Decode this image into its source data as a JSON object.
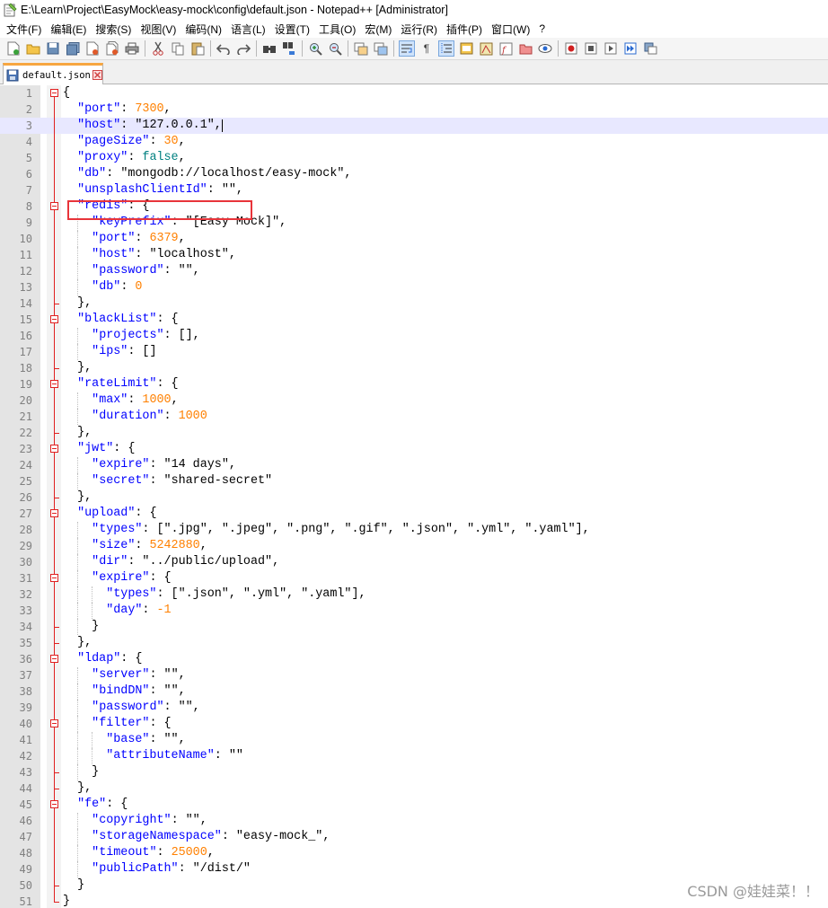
{
  "window": {
    "title": "E:\\Learn\\Project\\EasyMock\\easy-mock\\config\\default.json - Notepad++ [Administrator]"
  },
  "menu": [
    "文件(F)",
    "编辑(E)",
    "搜索(S)",
    "视图(V)",
    "编码(N)",
    "语言(L)",
    "设置(T)",
    "工具(O)",
    "宏(M)",
    "运行(R)",
    "插件(P)",
    "窗口(W)",
    "?"
  ],
  "toolbar": {
    "icons": [
      "new-file-icon",
      "open-file-icon",
      "save-icon",
      "save-all-icon",
      "close-icon",
      "close-all-icon",
      "print-icon",
      "cut-icon",
      "copy-icon",
      "paste-icon",
      "undo-icon",
      "redo-icon",
      "find-icon",
      "replace-icon",
      "zoom-in-icon",
      "zoom-out-icon",
      "sync-vertical-icon",
      "sync-horizontal-icon",
      "word-wrap-icon",
      "show-all-chars-icon",
      "indent-guide-icon",
      "udl-icon",
      "doc-map-icon",
      "function-list-icon",
      "folder-workspace-icon",
      "monitoring-icon",
      "record-macro-icon",
      "stop-macro-icon",
      "play-macro-icon",
      "run-macro-multiple-icon",
      "save-macro-icon"
    ]
  },
  "tab": {
    "label": "default.json"
  },
  "editor": {
    "current_line": 3,
    "lines": [
      {
        "n": "1",
        "t": "{"
      },
      {
        "n": "2",
        "t": "  \"port\": 7300,"
      },
      {
        "n": "3",
        "t": "  \"host\": \"127.0.0.1\","
      },
      {
        "n": "4",
        "t": "  \"pageSize\": 30,"
      },
      {
        "n": "5",
        "t": "  \"proxy\": false,"
      },
      {
        "n": "6",
        "t": "  \"db\": \"mongodb://localhost/easy-mock\","
      },
      {
        "n": "7",
        "t": "  \"unsplashClientId\": \"\","
      },
      {
        "n": "8",
        "t": "  \"redis\": {"
      },
      {
        "n": "9",
        "t": "    \"keyPrefix\": \"[Easy Mock]\","
      },
      {
        "n": "10",
        "t": "    \"port\": 6379,"
      },
      {
        "n": "11",
        "t": "    \"host\": \"localhost\","
      },
      {
        "n": "12",
        "t": "    \"password\": \"\","
      },
      {
        "n": "13",
        "t": "    \"db\": 0"
      },
      {
        "n": "14",
        "t": "  },"
      },
      {
        "n": "15",
        "t": "  \"blackList\": {"
      },
      {
        "n": "16",
        "t": "    \"projects\": [],"
      },
      {
        "n": "17",
        "t": "    \"ips\": []"
      },
      {
        "n": "18",
        "t": "  },"
      },
      {
        "n": "19",
        "t": "  \"rateLimit\": {"
      },
      {
        "n": "20",
        "t": "    \"max\": 1000,"
      },
      {
        "n": "21",
        "t": "    \"duration\": 1000"
      },
      {
        "n": "22",
        "t": "  },"
      },
      {
        "n": "23",
        "t": "  \"jwt\": {"
      },
      {
        "n": "24",
        "t": "    \"expire\": \"14 days\","
      },
      {
        "n": "25",
        "t": "    \"secret\": \"shared-secret\""
      },
      {
        "n": "26",
        "t": "  },"
      },
      {
        "n": "27",
        "t": "  \"upload\": {"
      },
      {
        "n": "28",
        "t": "    \"types\": [\".jpg\", \".jpeg\", \".png\", \".gif\", \".json\", \".yml\", \".yaml\"],"
      },
      {
        "n": "29",
        "t": "    \"size\": 5242880,"
      },
      {
        "n": "30",
        "t": "    \"dir\": \"../public/upload\","
      },
      {
        "n": "31",
        "t": "    \"expire\": {"
      },
      {
        "n": "32",
        "t": "      \"types\": [\".json\", \".yml\", \".yaml\"],"
      },
      {
        "n": "33",
        "t": "      \"day\": -1"
      },
      {
        "n": "34",
        "t": "    }"
      },
      {
        "n": "35",
        "t": "  },"
      },
      {
        "n": "36",
        "t": "  \"ldap\": {"
      },
      {
        "n": "37",
        "t": "    \"server\": \"\","
      },
      {
        "n": "38",
        "t": "    \"bindDN\": \"\","
      },
      {
        "n": "39",
        "t": "    \"password\": \"\","
      },
      {
        "n": "40",
        "t": "    \"filter\": {"
      },
      {
        "n": "41",
        "t": "      \"base\": \"\","
      },
      {
        "n": "42",
        "t": "      \"attributeName\": \"\""
      },
      {
        "n": "43",
        "t": "    }"
      },
      {
        "n": "44",
        "t": "  },"
      },
      {
        "n": "45",
        "t": "  \"fe\": {"
      },
      {
        "n": "46",
        "t": "    \"copyright\": \"\","
      },
      {
        "n": "47",
        "t": "    \"storageNamespace\": \"easy-mock_\","
      },
      {
        "n": "48",
        "t": "    \"timeout\": 25000,"
      },
      {
        "n": "49",
        "t": "    \"publicPath\": \"/dist/\""
      },
      {
        "n": "50",
        "t": "  }"
      },
      {
        "n": "51",
        "t": "}"
      }
    ]
  },
  "watermark": "CSDN @娃娃菜！！",
  "colors": {
    "key": "#0000ff",
    "number": "#ff8000",
    "boolean": "#008080",
    "fold_marker": "#e02020",
    "highlight_box": "#e8343a",
    "tab_accent": "#f7a640"
  }
}
